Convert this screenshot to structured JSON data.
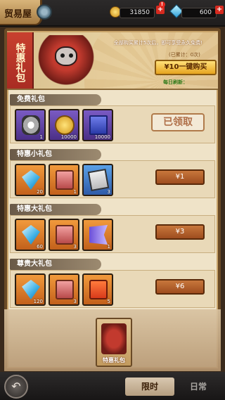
{
  "header": {
    "title": "贸易屋",
    "coins": "31850",
    "gems": "600",
    "plus": "+",
    "notice_badge": "!"
  },
  "banner": {
    "ribbon_text": "特惠礼包",
    "promo_text": "全部购买累计5次后，即可享受永久免费!",
    "purchased_count": "(已累计：0次)",
    "buy_button": "¥10一键购买",
    "time_label": "每日刷新："
  },
  "sections": [
    {
      "name": "免费礼包",
      "items": [
        {
          "icon": "fist-icon",
          "count": "1"
        },
        {
          "icon": "coin-icon",
          "count": "10000"
        },
        {
          "icon": "card-icon",
          "count": "10000"
        }
      ],
      "action": "已领取"
    },
    {
      "name": "特惠小礼包",
      "items": [
        {
          "icon": "diamond-icon",
          "count": "20"
        },
        {
          "icon": "chest-icon",
          "count": "1"
        },
        {
          "icon": "ticket-icon",
          "count": "3"
        }
      ],
      "action": "¥1"
    },
    {
      "name": "特惠大礼包",
      "items": [
        {
          "icon": "diamond-icon",
          "count": "60"
        },
        {
          "icon": "chest-icon",
          "count": "3"
        },
        {
          "icon": "flag-icon",
          "count": "1"
        }
      ],
      "action": "¥3"
    },
    {
      "name": "尊贵大礼包",
      "items": [
        {
          "icon": "diamond-icon",
          "count": "120"
        },
        {
          "icon": "chest-icon",
          "count": "3"
        },
        {
          "icon": "gift-icon",
          "count": "5"
        }
      ],
      "action": "¥6"
    }
  ],
  "mini_tab": "特惠礼包",
  "bottom": {
    "back_icon": "↶",
    "tab_active": "限时",
    "tab_inactive": "日常"
  }
}
